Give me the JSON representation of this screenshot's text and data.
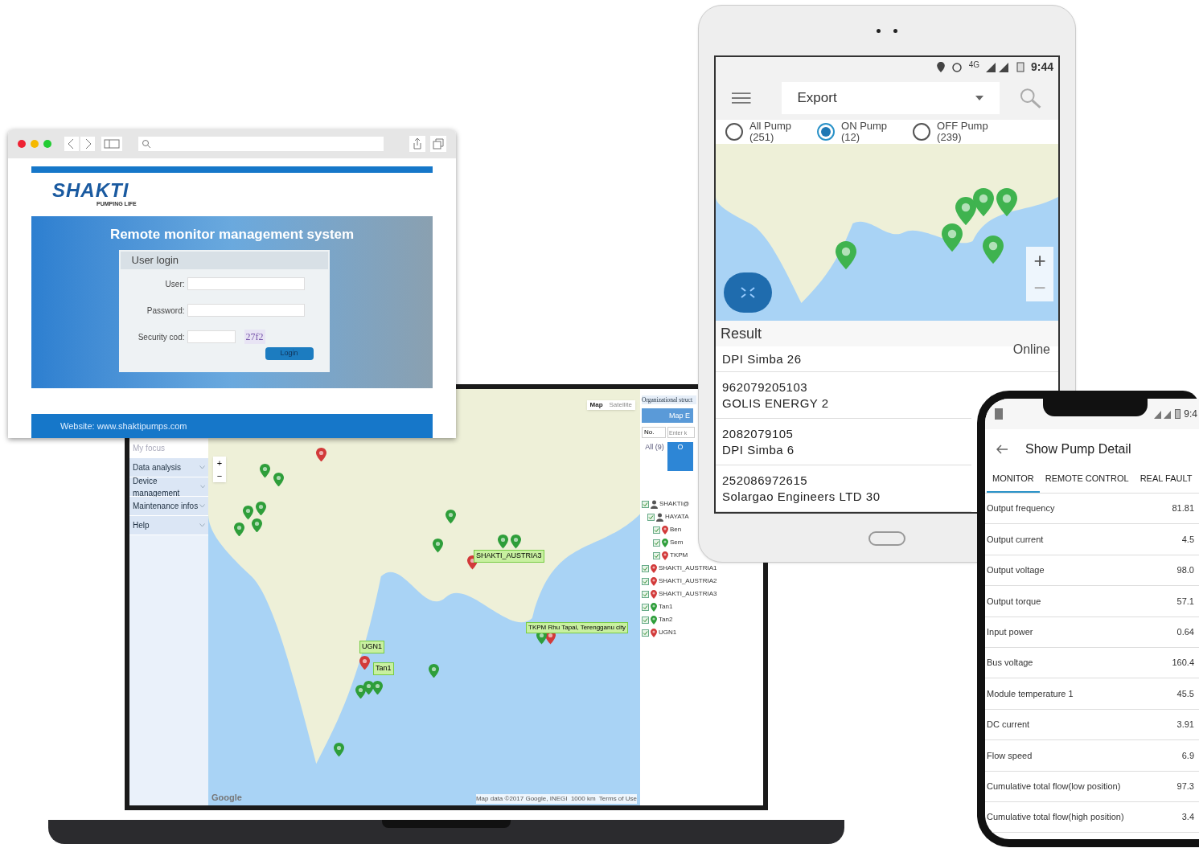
{
  "laptop": {
    "sidebar": [
      {
        "label": "My focus",
        "disabled": true
      },
      {
        "label": "Data analysis",
        "disabled": false
      },
      {
        "label": "Device management",
        "disabled": false
      },
      {
        "label": "Maintenance infos",
        "disabled": false
      },
      {
        "label": "Help",
        "disabled": false
      }
    ],
    "map": {
      "types": [
        {
          "label": "Map",
          "selected": true
        },
        {
          "label": "Satellite",
          "selected": false
        }
      ],
      "zoom_in": "+",
      "zoom_out": "−",
      "attribution": "Google",
      "footer": "Map data ©2017 Google, INEGI  1000 km  Terms of Use",
      "markers": [
        {
          "color": "#2e9e3a"
        },
        {
          "color": "#2e9e3a"
        },
        {
          "color": "#2e9e3a"
        },
        {
          "color": "#2e9e3a"
        },
        {
          "color": "#2e9e3a"
        },
        {
          "color": "#2e9e3a"
        },
        {
          "color": "#2e9e3a"
        },
        {
          "color": "#2e9e3a"
        },
        {
          "color": "#d23a3a"
        },
        {
          "color": "#2e9e3a"
        },
        {
          "color": "#2e9e3a"
        },
        {
          "color": "#d23a3a"
        },
        {
          "color": "#2e9e3a"
        },
        {
          "color": "#2e9e3a"
        },
        {
          "color": "#2e9e3a"
        },
        {
          "color": "#2e9e3a"
        },
        {
          "color": "#2e9e3a"
        },
        {
          "color": "#d23a3a"
        },
        {
          "color": "#2e9e3a"
        },
        {
          "color": "#d23a3a"
        }
      ],
      "labels": [
        "SHAKTI_AUSTRIA3",
        "TKPM Rhu Tapai, Terengganu city",
        "UGN1",
        "Tan1"
      ]
    },
    "panel": {
      "title": "Organizational struct",
      "button": "Map E",
      "select": "No.",
      "placeholder": "Enter k",
      "tabs": [
        {
          "label": "All (9)",
          "selected": false
        },
        {
          "label": "O",
          "selected": true
        }
      ],
      "tree": [
        {
          "label": "SHAKTI@",
          "kind": "user",
          "checked": true,
          "children": [
            {
              "label": "HAYATA",
              "kind": "user",
              "checked": true,
              "children": [
                {
                  "label": "Ben",
                  "kind": "pin",
                  "color": "#d23a3a",
                  "checked": true
                },
                {
                  "label": "Sem",
                  "kind": "pin",
                  "color": "#2e9e3a",
                  "checked": true
                },
                {
                  "label": "TKPM",
                  "kind": "pin",
                  "color": "#d23a3a",
                  "checked": true
                }
              ]
            }
          ]
        },
        {
          "label": "SHAKTI_AUSTRIA1",
          "kind": "pin",
          "color": "#d23a3a",
          "checked": true
        },
        {
          "label": "SHAKTI_AUSTRIA2",
          "kind": "pin",
          "color": "#d23a3a",
          "checked": true
        },
        {
          "label": "SHAKTI_AUSTRIA3",
          "kind": "pin",
          "color": "#d23a3a",
          "checked": true
        },
        {
          "label": "Tan1",
          "kind": "pin",
          "color": "#2e9e3a",
          "checked": true
        },
        {
          "label": "Tan2",
          "kind": "pin",
          "color": "#2e9e3a",
          "checked": true
        },
        {
          "label": "UGN1",
          "kind": "pin",
          "color": "#d23a3a",
          "checked": true
        }
      ]
    }
  },
  "browser": {
    "logo": "SHAKTI",
    "tagline": "PUMPING LIFE",
    "heading": "Remote monitor management system",
    "login_title": "User login",
    "fields": [
      {
        "label": "User:"
      },
      {
        "label": "Password:"
      },
      {
        "label": "Security cod:"
      }
    ],
    "captcha": "27f2",
    "button": "Login",
    "footer": "Website: www.shaktipumps.com"
  },
  "tablet": {
    "status": {
      "network": "4G",
      "time": "9:44"
    },
    "dropdown": "Export",
    "filters": [
      {
        "label": "All Pump",
        "count": "(251)",
        "selected": false
      },
      {
        "label": "ON Pump",
        "count": "(12)",
        "selected": true
      },
      {
        "label": "OFF Pump",
        "count": "(239)",
        "selected": false
      }
    ],
    "map": {
      "markers": [
        {
          "color": "#3fb34f"
        },
        {
          "color": "#3fb34f"
        },
        {
          "color": "#3fb34f"
        },
        {
          "color": "#3fb34f"
        },
        {
          "color": "#3fb34f"
        },
        {
          "color": "#3fb34f"
        }
      ],
      "zoom_in": "+",
      "zoom_out": "−"
    },
    "result_title": "Result",
    "first_status": "Online",
    "results": [
      {
        "lines": [
          "DPI Simba 26"
        ]
      },
      {
        "lines": [
          "962079205103",
          "GOLIS ENERGY 2"
        ]
      },
      {
        "lines": [
          "2082079105",
          "DPI Simba 6"
        ]
      },
      {
        "lines": [
          "252086972615",
          "Solargao Engineers LTD 30"
        ]
      }
    ]
  },
  "phone": {
    "status": {
      "time": "9:4"
    },
    "title": "Show Pump Detail",
    "tabs": [
      {
        "label": "MONITOR",
        "selected": true
      },
      {
        "label": "REMOTE CONTROL",
        "selected": false
      },
      {
        "label": "REAL FAULT",
        "selected": false
      }
    ],
    "rows": [
      {
        "label": "Output frequency",
        "value": "81.81"
      },
      {
        "label": "Output current",
        "value": "4.5"
      },
      {
        "label": "Output voltage",
        "value": "98.0"
      },
      {
        "label": "Output torque",
        "value": "57.1"
      },
      {
        "label": "Input power",
        "value": "0.64"
      },
      {
        "label": "Bus voltage",
        "value": "160.4"
      },
      {
        "label": "Module temperature 1",
        "value": "45.5"
      },
      {
        "label": "DC current",
        "value": "3.91"
      },
      {
        "label": "Flow speed",
        "value": "6.9"
      },
      {
        "label": "Cumulative total flow(low position)",
        "value": "97.3"
      },
      {
        "label": "Cumulative total flow(high position)",
        "value": "3.4"
      }
    ]
  }
}
